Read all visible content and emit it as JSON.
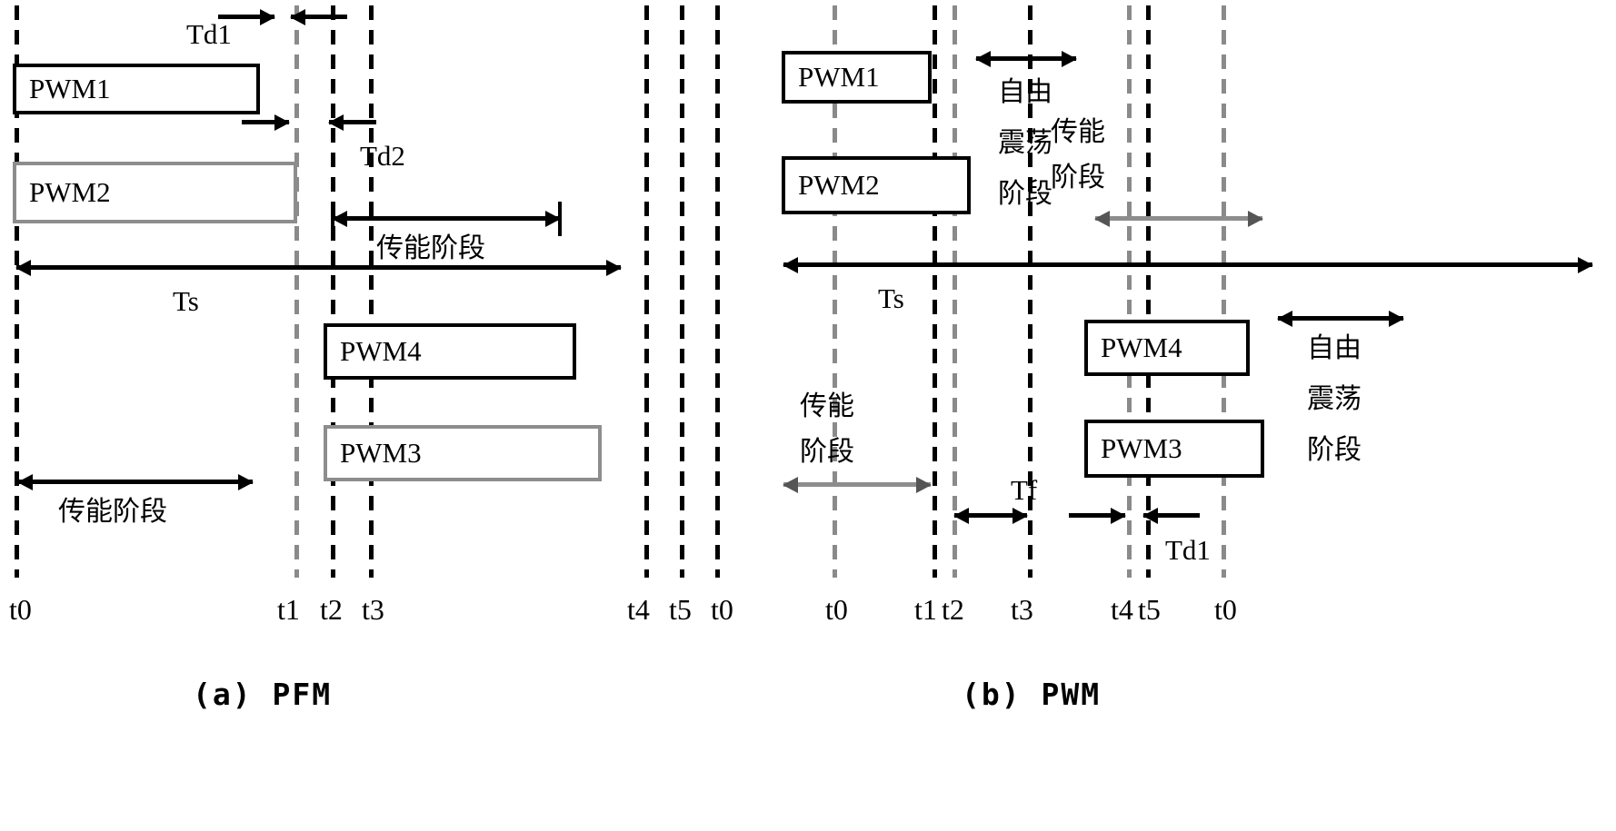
{
  "figure": {
    "title_a": "(a) PFM",
    "title_b": "(b) PWM"
  },
  "panel_a": {
    "caption": "(a) PFM",
    "signals": [
      {
        "name": "PWM1",
        "label": "PWM1"
      },
      {
        "name": "PWM2",
        "label": "PWM2"
      },
      {
        "name": "PWM4",
        "label": "PWM4"
      },
      {
        "name": "PWM3",
        "label": "PWM3"
      }
    ],
    "annotations": {
      "td1": "Td1",
      "td2": "Td2",
      "ts": "Ts",
      "transfer_phase_top": "传能阶段",
      "transfer_phase_bottom": "传能阶段"
    },
    "time_ticks": [
      "t0",
      "t1",
      "t2",
      "t3",
      "t4",
      "t5",
      "t0"
    ]
  },
  "panel_b": {
    "caption": "(b) PWM",
    "signals": [
      {
        "name": "PWM1",
        "label": "PWM1"
      },
      {
        "name": "PWM2",
        "label": "PWM2"
      },
      {
        "name": "PWM4",
        "label": "PWM4"
      },
      {
        "name": "PWM3",
        "label": "PWM3"
      }
    ],
    "annotations": {
      "free_osc_top_l1": "自由",
      "free_osc_top_l2": "震荡",
      "free_osc_top_l3": "阶段",
      "transfer_top_l1": "传能",
      "transfer_top_l2": "阶段",
      "transfer_left_l1": "传能",
      "transfer_left_l2": "阶段",
      "free_osc_right_l1": "自由",
      "free_osc_right_l2": "震荡",
      "free_osc_right_l3": "阶段",
      "ts": "Ts",
      "tf": "Tf",
      "td1": "Td1"
    },
    "time_ticks": [
      "t0",
      "t1",
      "t2",
      "t3",
      "t4",
      "t5",
      "t0"
    ]
  },
  "colors": {
    "line": "#000000",
    "grey_line": "#8d8d8d",
    "background": "#ffffff"
  }
}
